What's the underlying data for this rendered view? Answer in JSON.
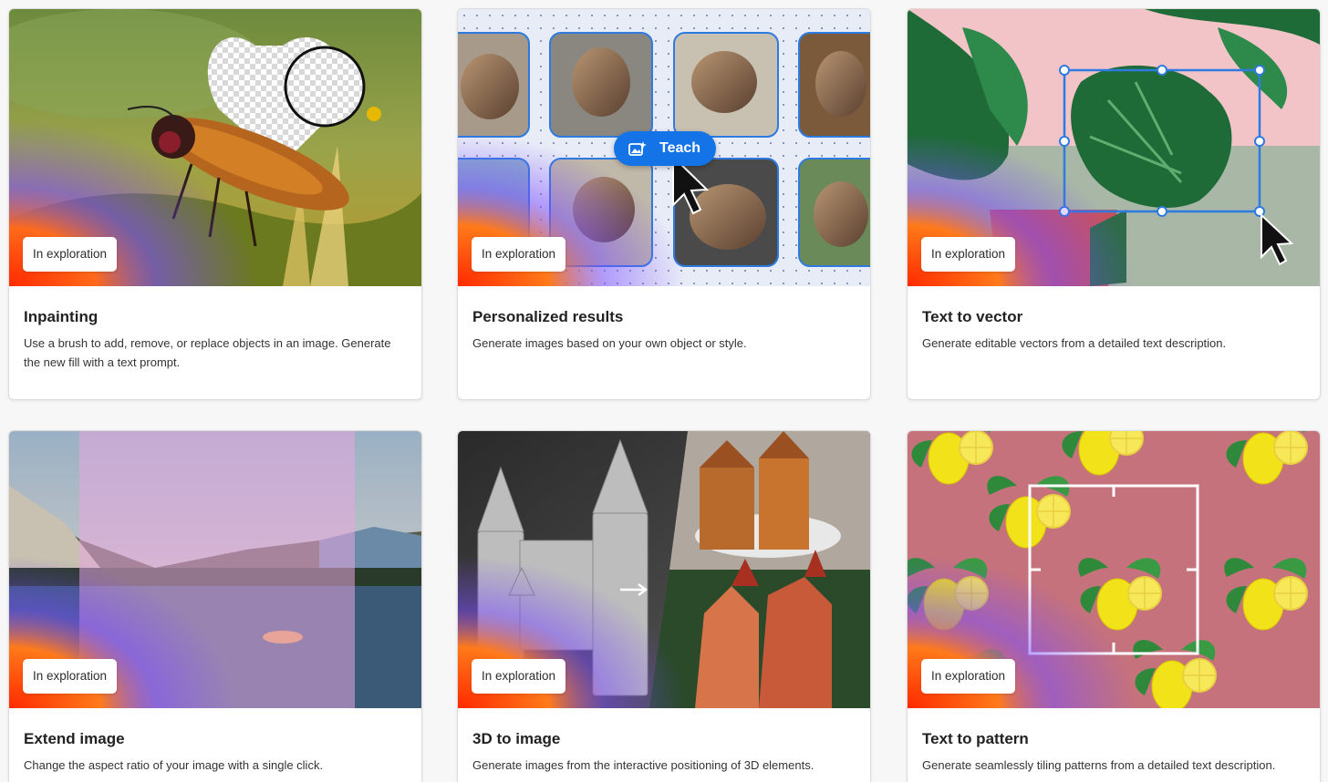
{
  "cards": [
    {
      "title": "Inpainting",
      "description": "Use a brush to add, remove, or replace objects in an image. Generate the new fill with a text prompt.",
      "badge": "In exploration"
    },
    {
      "title": "Personalized results",
      "description": "Generate images based on your own object or style.",
      "badge": "In exploration",
      "button": "Teach"
    },
    {
      "title": "Text to vector",
      "description": "Generate editable vectors from a detailed text description.",
      "badge": "In exploration"
    },
    {
      "title": "Extend image",
      "description": "Change the aspect ratio of your image with a single click.",
      "badge": "In exploration"
    },
    {
      "title": "3D to image",
      "description": "Generate images from the interactive positioning of 3D elements.",
      "badge": "In exploration"
    },
    {
      "title": "Text to pattern",
      "description": "Generate seamlessly tiling patterns from a detailed text description.",
      "badge": "In exploration"
    }
  ],
  "colors": {
    "accent": "#1473e6",
    "selection": "#2d7be0"
  }
}
